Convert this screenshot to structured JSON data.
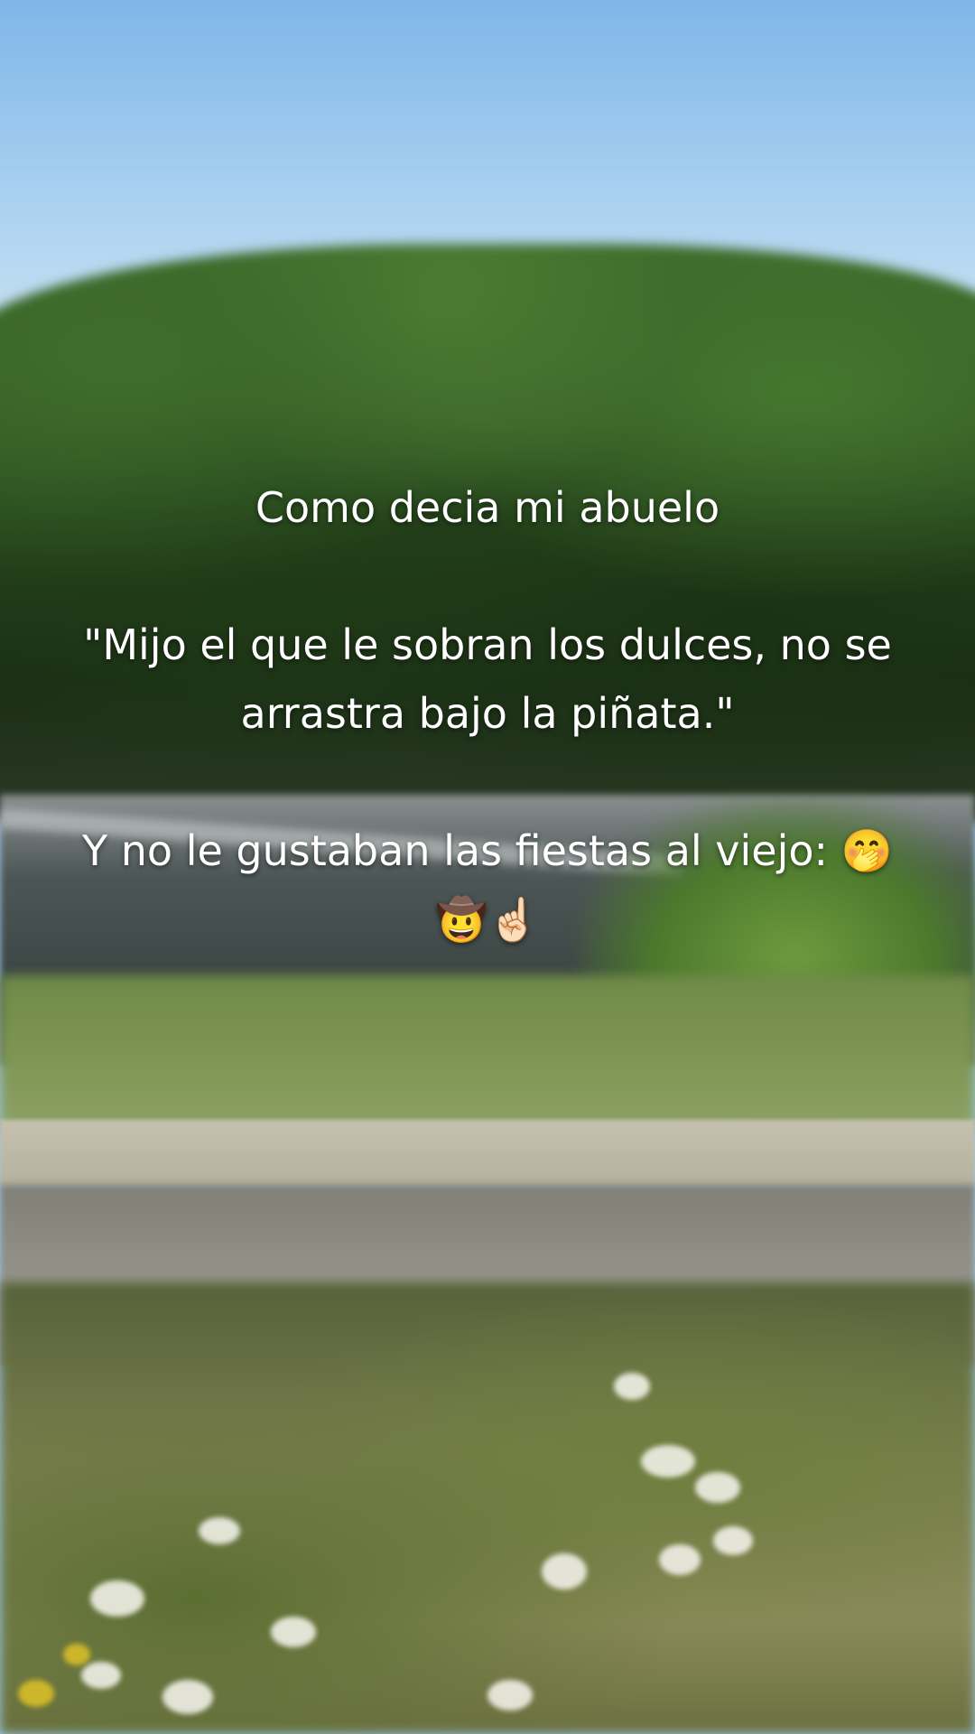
{
  "caption": {
    "text": "Como decia mi abuelo\n\n\"Mijo el que le sobran los dulces, no se arrastra bajo la piñata.\"\n\nY no le gustaban las fiestas al viejo: 🤭🤠☝🏻"
  },
  "scene": {
    "colors": {
      "sky": "#9cc8ea",
      "trees": "#2c4f20",
      "river": "#4d5656",
      "wall": "#c6c1ae",
      "text": "#ffffff"
    }
  }
}
